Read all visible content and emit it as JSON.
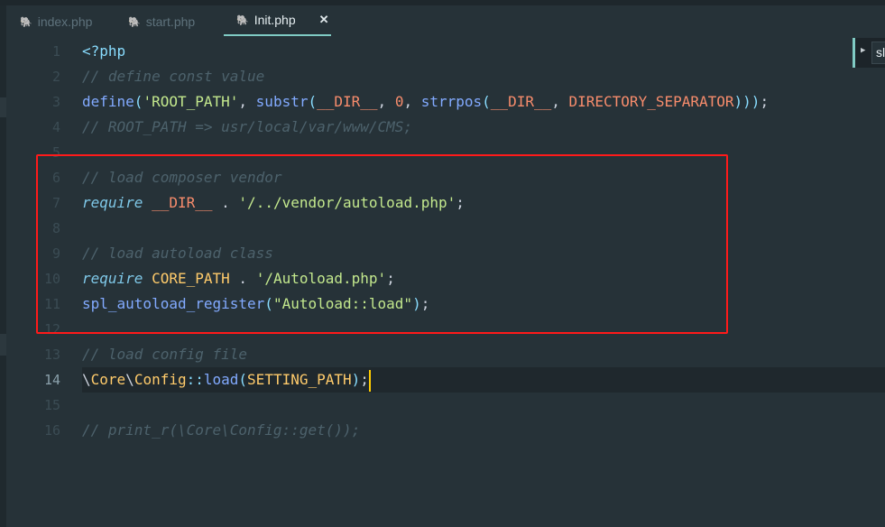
{
  "tabs": [
    {
      "label": "index.php",
      "icon": "php-elephant-icon",
      "active": false
    },
    {
      "label": "start.php",
      "icon": "php-elephant-icon",
      "active": false
    },
    {
      "label": "Init.php",
      "icon": "php-elephant-icon",
      "active": true,
      "close": "✕"
    }
  ],
  "panel": {
    "text": "sli"
  },
  "current_line": 14,
  "lines": [
    {
      "n": "1",
      "tokens": [
        [
          "tag",
          "<?php"
        ]
      ]
    },
    {
      "n": "2",
      "tokens": [
        [
          "cm",
          "// define const value"
        ]
      ]
    },
    {
      "n": "3",
      "tokens": [
        [
          "fn",
          "define"
        ],
        [
          "pn",
          "("
        ],
        [
          "str",
          "'ROOT_PATH'"
        ],
        [
          "tx",
          ", "
        ],
        [
          "fn",
          "substr"
        ],
        [
          "pn",
          "("
        ],
        [
          "const",
          "__DIR__"
        ],
        [
          "tx",
          ", "
        ],
        [
          "const",
          "0"
        ],
        [
          "tx",
          ", "
        ],
        [
          "fn",
          "strrpos"
        ],
        [
          "pn",
          "("
        ],
        [
          "const",
          "__DIR__"
        ],
        [
          "tx",
          ", "
        ],
        [
          "const",
          "DIRECTORY_SEPARATOR"
        ],
        [
          "pn",
          ")))"
        ],
        [
          "tx",
          ";"
        ]
      ]
    },
    {
      "n": "4",
      "tokens": [
        [
          "cm",
          "// ROOT_PATH => usr/local/var/www/CMS;"
        ]
      ]
    },
    {
      "n": "5",
      "tokens": []
    },
    {
      "n": "6",
      "tokens": [
        [
          "cm",
          "// load composer vendor"
        ]
      ]
    },
    {
      "n": "7",
      "tokens": [
        [
          "kw",
          "require"
        ],
        [
          "tx",
          " "
        ],
        [
          "const",
          "__DIR__"
        ],
        [
          "tx",
          " . "
        ],
        [
          "str",
          "'/../vendor/autoload.php'"
        ],
        [
          "tx",
          ";"
        ]
      ]
    },
    {
      "n": "8",
      "tokens": []
    },
    {
      "n": "9",
      "tokens": [
        [
          "cm",
          "// load autoload class"
        ]
      ]
    },
    {
      "n": "10",
      "tokens": [
        [
          "kw",
          "require"
        ],
        [
          "tx",
          " "
        ],
        [
          "cls",
          "CORE_PATH"
        ],
        [
          "tx",
          " . "
        ],
        [
          "str",
          "'/Autoload.php'"
        ],
        [
          "tx",
          ";"
        ]
      ]
    },
    {
      "n": "11",
      "tokens": [
        [
          "fn",
          "spl_autoload_register"
        ],
        [
          "pn",
          "("
        ],
        [
          "str",
          "\"Autoload::load\""
        ],
        [
          "pn",
          ")"
        ],
        [
          "tx",
          ";"
        ]
      ]
    },
    {
      "n": "12",
      "tokens": []
    },
    {
      "n": "13",
      "tokens": [
        [
          "cm",
          "// load config file"
        ]
      ]
    },
    {
      "n": "14",
      "tokens": [
        [
          "tx",
          "\\"
        ],
        [
          "cls",
          "Core"
        ],
        [
          "tx",
          "\\"
        ],
        [
          "cls",
          "Config"
        ],
        [
          "pn",
          "::"
        ],
        [
          "fn",
          "load"
        ],
        [
          "pn",
          "("
        ],
        [
          "cls",
          "SETTING_PATH"
        ],
        [
          "pn",
          ")"
        ],
        [
          "tx",
          ";"
        ]
      ]
    },
    {
      "n": "15",
      "tokens": []
    },
    {
      "n": "16",
      "tokens": [
        [
          "cm",
          "// print_r(\\Core\\Config::get());"
        ]
      ]
    }
  ],
  "colors": {
    "background": "#263238",
    "highlight_box": "#ff1a1a",
    "accent": "#80cbc4",
    "cursor": "#ffcc00"
  }
}
